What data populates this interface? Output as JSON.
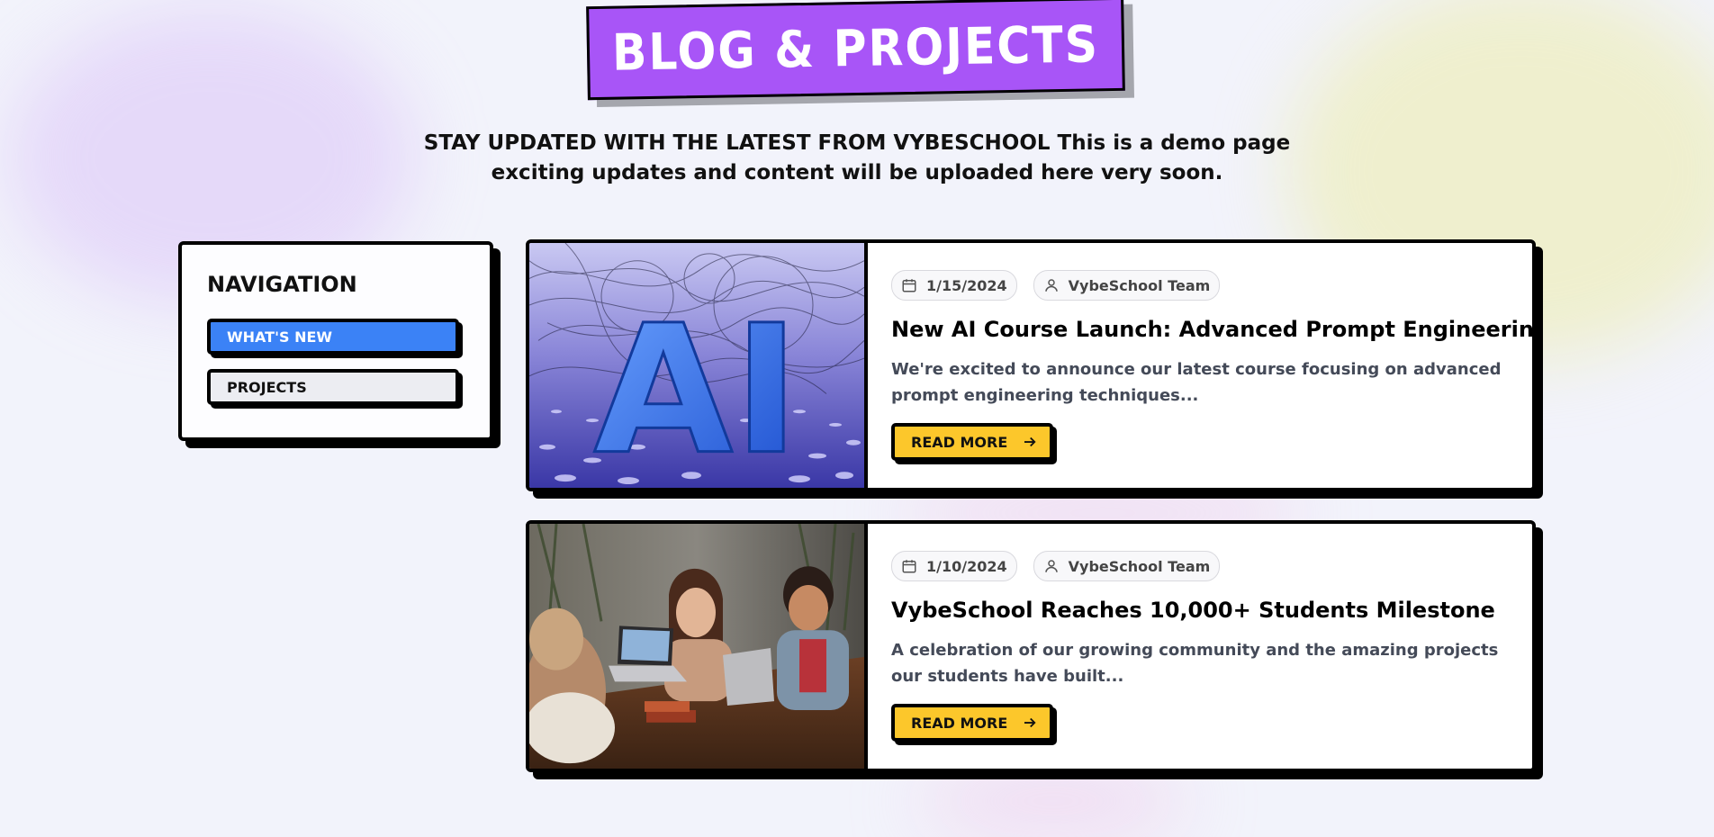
{
  "header": {
    "title": "BLOG & PROJECTS",
    "subtitle": "STAY UPDATED WITH THE LATEST FROM VYBESCHOOL This is a demo page exciting updates and content will be uploaded here very soon."
  },
  "navigation": {
    "title": "NAVIGATION",
    "items": [
      {
        "label": "WHAT'S NEW",
        "active": true
      },
      {
        "label": "PROJECTS",
        "active": false
      }
    ]
  },
  "posts": [
    {
      "date": "1/15/2024",
      "author": "VybeSchool Team",
      "title": "New AI Course Launch: Advanced Prompt Engineering",
      "excerpt": "We're excited to announce our latest course focusing on advanced prompt engineering techniques...",
      "button_label": "READ MORE",
      "image_label": "AI"
    },
    {
      "date": "1/10/2024",
      "author": "VybeSchool Team",
      "title": "VybeSchool Reaches 10,000+ Students Milestone",
      "excerpt": "A celebration of our growing community and the amazing projects our students have built...",
      "button_label": "READ MORE"
    }
  ],
  "colors": {
    "title_badge": "#a855f7",
    "active_nav": "#3b82f6",
    "read_more": "#fcc72b"
  },
  "icons": {
    "date": "calendar-icon",
    "author": "user-icon",
    "read_more": "arrow-right-icon"
  }
}
